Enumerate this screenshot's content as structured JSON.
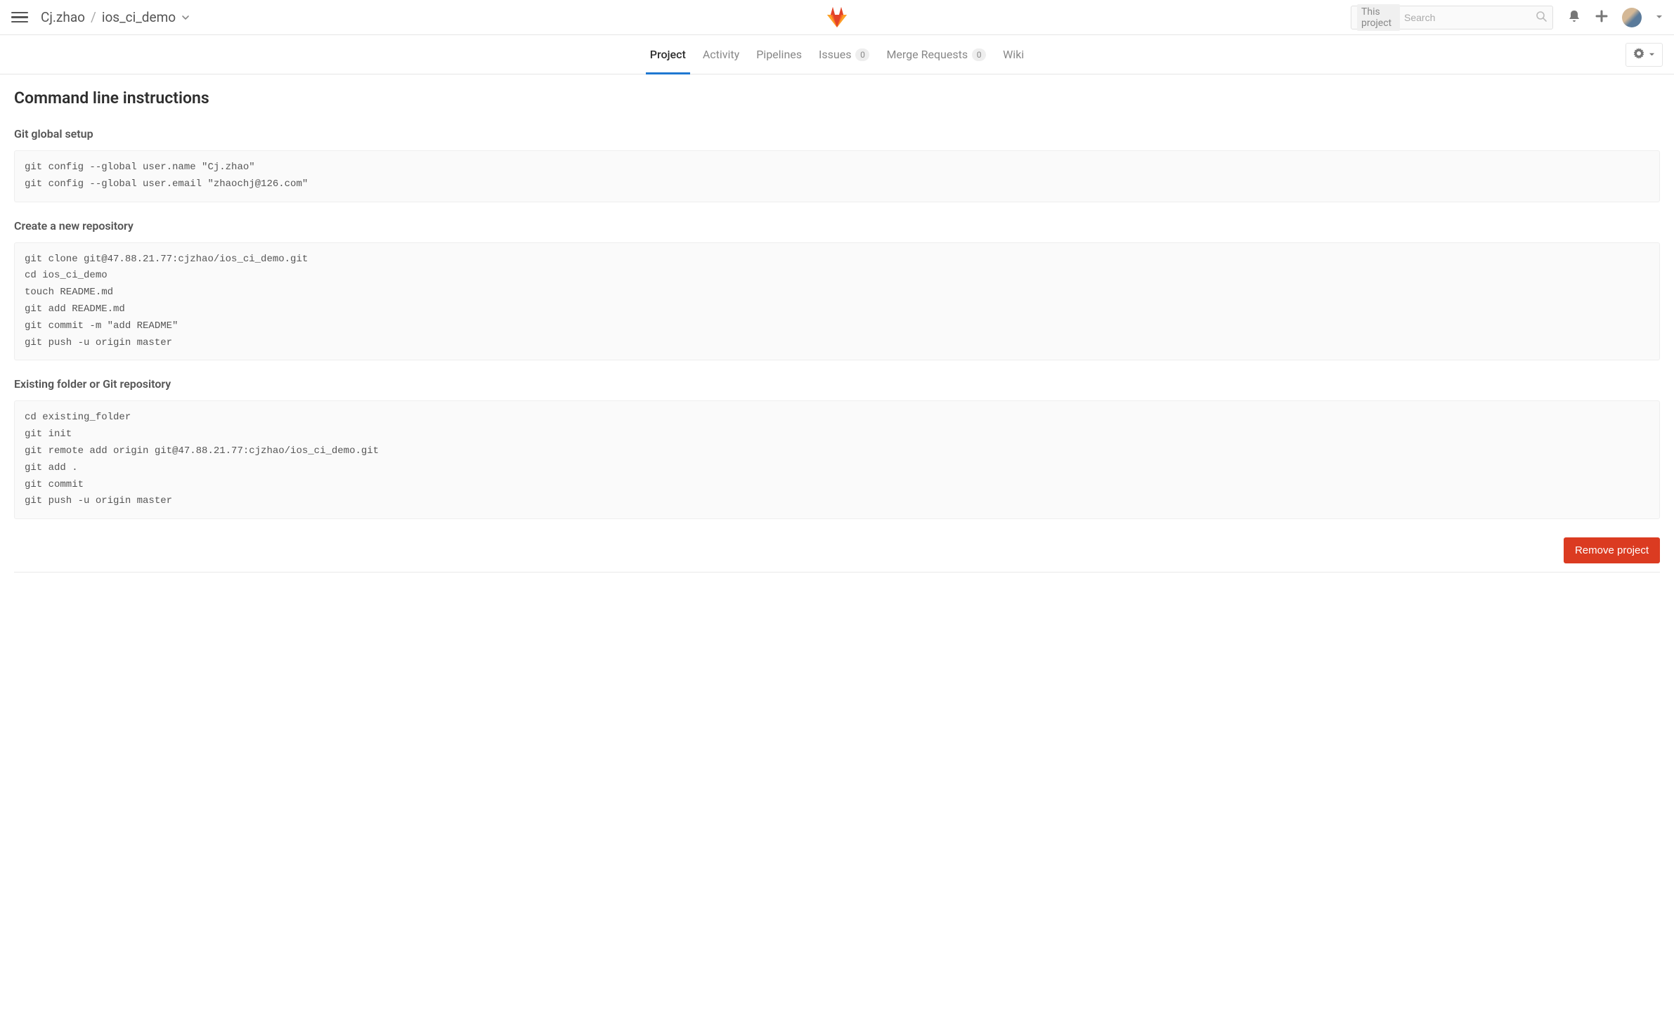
{
  "header": {
    "breadcrumb_user": "Cj.zhao",
    "breadcrumb_sep": "/",
    "breadcrumb_project": "ios_ci_demo",
    "search_scope": "This project",
    "search_placeholder": "Search"
  },
  "subnav": {
    "tabs": [
      {
        "label": "Project",
        "active": true
      },
      {
        "label": "Activity"
      },
      {
        "label": "Pipelines"
      },
      {
        "label": "Issues",
        "badge": "0"
      },
      {
        "label": "Merge Requests",
        "badge": "0"
      },
      {
        "label": "Wiki"
      }
    ]
  },
  "main": {
    "title": "Command line instructions",
    "sections": [
      {
        "heading": "Git global setup",
        "code": "git config --global user.name \"Cj.zhao\"\ngit config --global user.email \"zhaochj@126.com\""
      },
      {
        "heading": "Create a new repository",
        "code": "git clone git@47.88.21.77:cjzhao/ios_ci_demo.git\ncd ios_ci_demo\ntouch README.md\ngit add README.md\ngit commit -m \"add README\"\ngit push -u origin master"
      },
      {
        "heading": "Existing folder or Git repository",
        "code": "cd existing_folder\ngit init\ngit remote add origin git@47.88.21.77:cjzhao/ios_ci_demo.git\ngit add .\ngit commit\ngit push -u origin master"
      }
    ],
    "remove_label": "Remove project"
  }
}
